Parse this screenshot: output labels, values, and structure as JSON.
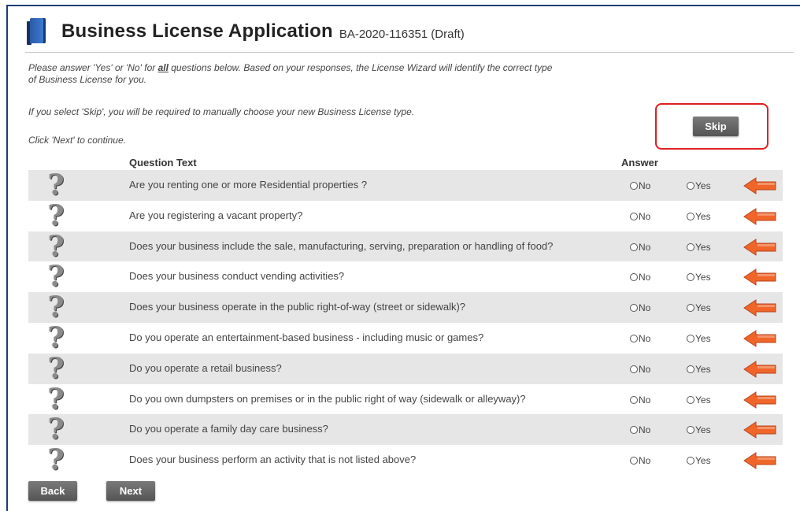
{
  "header": {
    "title": "Business License Application",
    "application_id": "BA-2020-116351 (Draft)"
  },
  "instructions": {
    "line1_a": "Please answer 'Yes' or 'No' for ",
    "line1_all": "all",
    "line1_b": " questions below. Based on your responses, the License Wizard will identify the correct type",
    "line1_c": "of Business License for you.",
    "line2": "If you select 'Skip', you will be required to manually choose your new Business License type.",
    "line3": "Click 'Next' to continue."
  },
  "buttons": {
    "skip": "Skip",
    "back": "Back",
    "next": "Next"
  },
  "table": {
    "col_question": "Question Text",
    "col_answer": "Answer",
    "option_no": "No",
    "option_yes": "Yes",
    "questions": [
      "Are you renting one or more Residential properties ?",
      "Are you registering a vacant property?",
      "Does your business include the sale, manufacturing, serving, preparation or handling of food?",
      "Does your business conduct vending activities?",
      "Does your business operate in the public right-of-way (street or sidewalk)?",
      "Do you operate an entertainment-based business - including music or games?",
      "Do you operate a retail business?",
      "Do you own dumpsters on premises or in the public right of way (sidewalk or alleyway)?",
      "Do you operate a family day care business?",
      "Does your business perform an activity that is not listed above?"
    ]
  },
  "icons": {
    "header": "book-icon",
    "question": "question-mark-icon",
    "indicator": "orange-left-arrow-icon"
  },
  "colors": {
    "frame_border": "#1f3b73",
    "highlight_box": "#e02020",
    "arrow": "#f0662a",
    "row_shade": "#e6e6e6",
    "button": "#666666"
  }
}
